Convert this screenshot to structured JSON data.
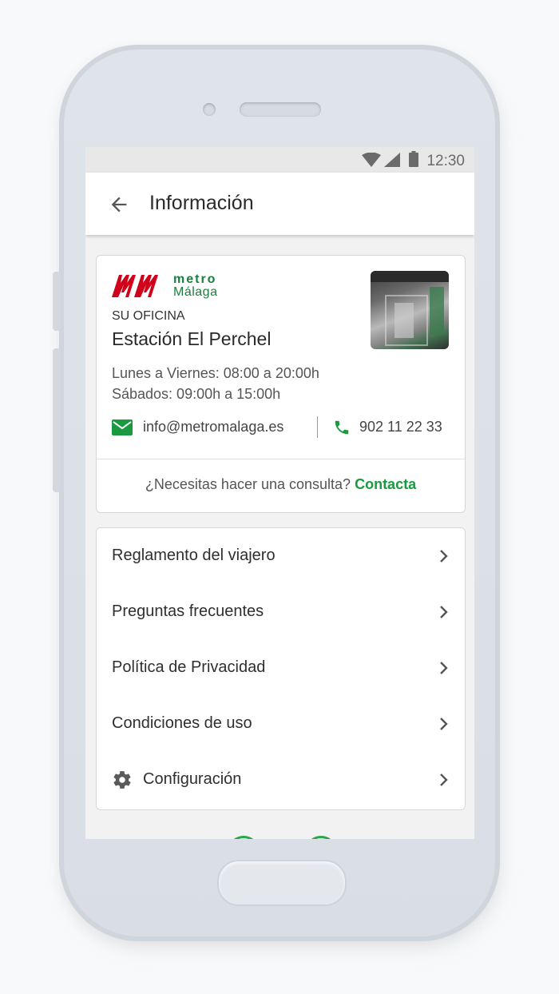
{
  "status_bar": {
    "time": "12:30",
    "icons": [
      "wifi-icon",
      "signal-icon",
      "battery-icon"
    ]
  },
  "app_bar": {
    "title": "Información",
    "back_icon": "arrow-back-icon"
  },
  "office": {
    "logo": {
      "metro": "metro",
      "city": "Málaga"
    },
    "label": "SU OFICINA",
    "name": "Estación El Perchel",
    "hours_weekdays": "Lunes a Viernes: 08:00 a 20:00h",
    "hours_saturday": "Sábados: 09:00h a 15:00h",
    "email": "info@metromalaga.es",
    "phone": "902 11 22 33",
    "consult_text": "¿Necesitas hacer una consulta?",
    "consult_link": "Contacta"
  },
  "menu": {
    "items": [
      {
        "label": "Reglamento del viajero"
      },
      {
        "label": "Preguntas frecuentes"
      },
      {
        "label": "Política de Privacidad"
      },
      {
        "label": "Condiciones de uso"
      },
      {
        "label": "Configuración",
        "icon": "gear-icon"
      }
    ]
  },
  "colors": {
    "accent": "#1a9a3f",
    "brand_red": "#d0021b"
  }
}
